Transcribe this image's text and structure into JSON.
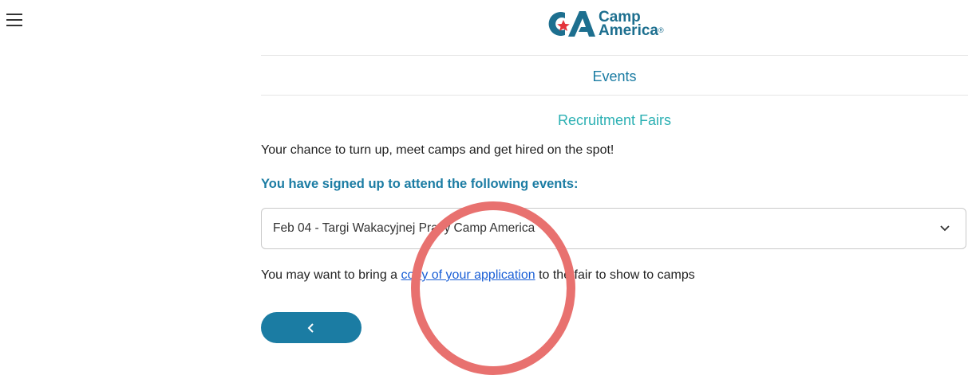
{
  "header": {
    "menu_icon": "hamburger-menu-icon",
    "logo": {
      "mark": "CA",
      "line1": "Camp",
      "line2": "America",
      "reg": "®",
      "color_primary": "#1d6f8f",
      "color_star": "#e4343b"
    }
  },
  "nav": {
    "events_label": "Events"
  },
  "page": {
    "subtitle": "Recruitment Fairs",
    "intro": "Your chance to turn up, meet camps and get hired on the spot!",
    "signed_heading": "You have signed up to attend the following events:",
    "event_select": {
      "selected": "Feb 04 - Targi Wakacyjnej Pracy Camp America",
      "icon": "chevron-down-icon"
    },
    "note": {
      "before": "You may want to bring a ",
      "link": "copy of your application",
      "after": " to the fair to show to camps"
    },
    "back_button": {
      "icon": "chevron-left-icon"
    }
  },
  "colors": {
    "accent": "#1b7ca3",
    "teal": "#2bb0b3",
    "link": "#1a5fd6",
    "annotation": "#e8716f"
  }
}
